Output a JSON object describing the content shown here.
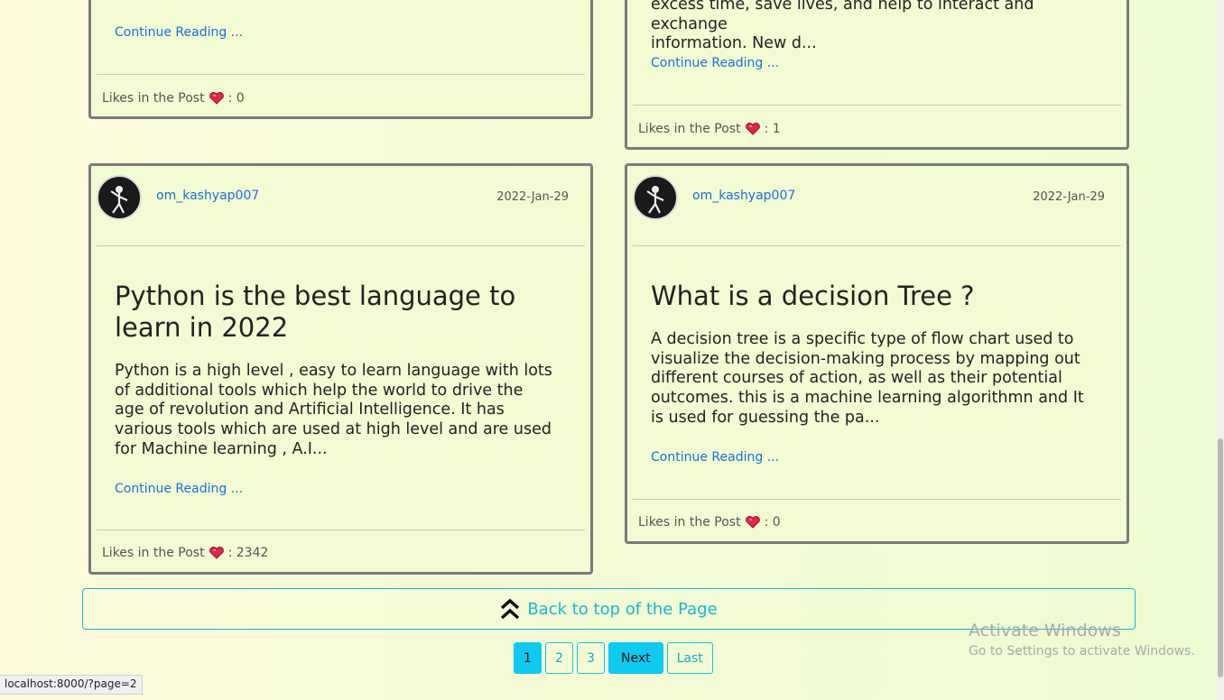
{
  "posts": [
    {
      "continue_label": "Continue Reading ...",
      "likes_label": "Likes in the Post",
      "likes_count": ": 0"
    },
    {
      "excerpt_tail_line1": "excess time, save lives, and help to interact and exchange",
      "excerpt_tail_line2": "information. New d...",
      "continue_label": "Continue Reading ...",
      "likes_label": "Likes in the Post",
      "likes_count": ": 1"
    },
    {
      "author": "om_kashyap007",
      "date": "2022-Jan-29",
      "title": "Python is the best language to learn in 2022",
      "excerpt": "Python is a high level , easy to learn language with lots of additional tools which help the world to drive the age of revolution and Artificial Intelligence. It has various tools which are used at high level and are used for Machine learning , A.I...",
      "continue_label": "Continue Reading ...",
      "likes_label": "Likes in the Post",
      "likes_count": ": 2342"
    },
    {
      "author": "om_kashyap007",
      "date": "2022-Jan-29",
      "title": "What is a decision Tree ?",
      "excerpt": "A decision tree is a specific type of flow chart used to visualize the decision-making process by mapping out different courses of action, as well as their potential outcomes. this is a machine learning algorithmn and It is used for guessing the pa...",
      "continue_label": "Continue Reading ...",
      "likes_label": "Likes in the Post",
      "likes_count": ": 0"
    }
  ],
  "back_to_top": "Back to top of the Page",
  "pagination": {
    "pages": [
      "1",
      "2",
      "3"
    ],
    "next": "Next",
    "last": "Last"
  },
  "watermark": {
    "line1": "Activate Windows",
    "line2": "Go to Settings to activate Windows."
  },
  "status_url": "localhost:8000/?page=2",
  "colors": {
    "accent": "#0dcaf0",
    "link": "#1a6fe0",
    "card_border": "#7a7a7a"
  }
}
